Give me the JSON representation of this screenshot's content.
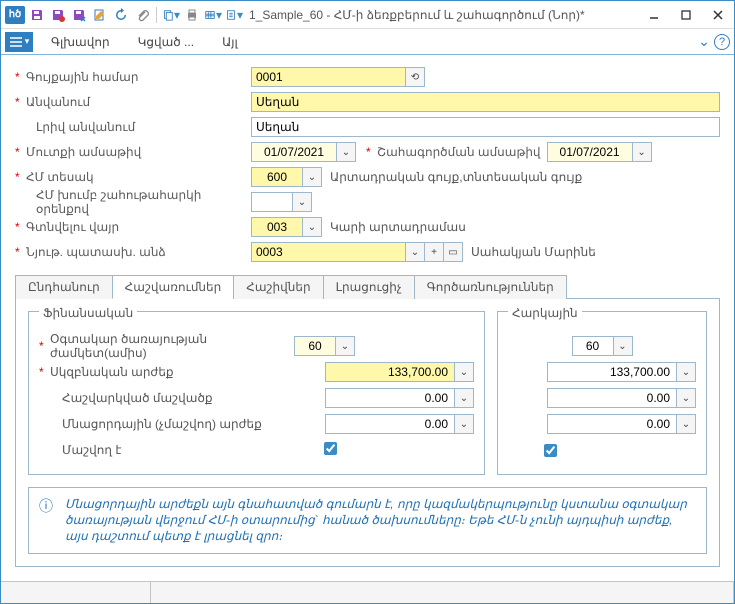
{
  "window": {
    "title": "1_Sample_60 - ՀՄ-ի ձեռքբերում և շահագործում (Նոր)*"
  },
  "menu": {
    "main": "Գլխավոր",
    "section": "Կցված ...",
    "other": "Այլ"
  },
  "form": {
    "inventory_no_lbl": "Գույքային համար",
    "inventory_no": "0001",
    "name_lbl": "Անվանում",
    "name": "Սեղան",
    "fullname_lbl": "Լրիվ անվանում",
    "fullname": "Սեղան",
    "entry_date_lbl": "Մուտքի ամսաթիվ",
    "entry_date": "01/07/2021",
    "op_date_lbl": "Շահագործման ամսաթիվ",
    "op_date": "01/07/2021",
    "hm_type_lbl": "ՀՄ տեսակ",
    "hm_type_code": "600",
    "hm_type_text": "Արտադրական գույք,տնտեսական գույք",
    "hm_group_lbl": "ՀՄ խումբ շահութահարկի օրենքով",
    "location_lbl": "Գտնվելու վայր",
    "location_code": "003",
    "location_text": "Կարի արտադրամաս",
    "resp_lbl": "Նյութ. պատասխ. անձ",
    "resp_code": "0003",
    "resp_text": "Սահակյան Մարինե"
  },
  "tabs": {
    "t1": "Ընդհանուր",
    "t2": "Հաշվառումներ",
    "t3": "Հաշիվներ",
    "t4": "Լրացուցիչ",
    "t5": "Գործառնություններ"
  },
  "fin": {
    "group_title": "Ֆինանսական",
    "life_lbl": "Օգտակար ծառայության ժամկետ(ամիս)",
    "life": "60",
    "init_lbl": "Սկզբնական արժեք",
    "init": "133,700.00",
    "depr_lbl": "Հաշվարկված մաշվածք",
    "depr": "0.00",
    "resid_lbl": "Մնացորդային (չմաշվող) արժեք",
    "resid": "0.00",
    "wear_lbl": "Մաշվող է"
  },
  "tax": {
    "group_title": "Հարկային",
    "life": "60",
    "init": "133,700.00",
    "depr": "0.00",
    "resid": "0.00"
  },
  "info": {
    "text": "Մնացորդային արժեքն այն գնահատված գումարն է, որը կազմակերպությունը կստանա օգտակար ծառայության վերջում ՀՄ-ի օտարումից` հանած ծախսումները։ Եթե ՀՄ-ն չունի այդպիսի արժեք, այս դաշտում պետք է լրացնել զրո։"
  }
}
